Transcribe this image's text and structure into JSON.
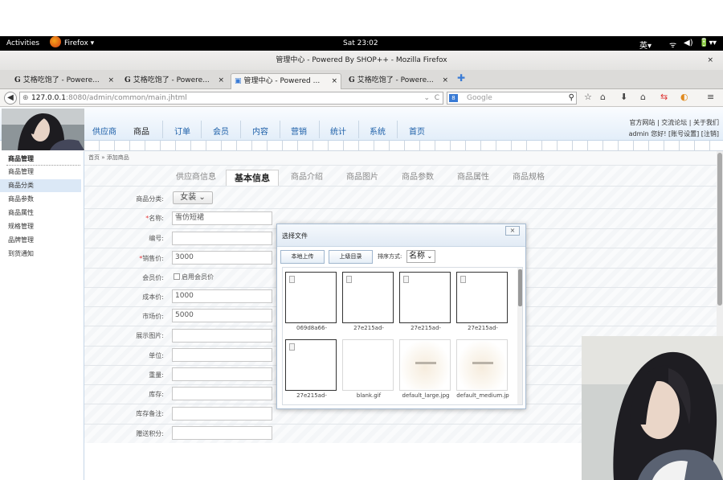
{
  "system": {
    "activities": "Activities",
    "app_menu": "Firefox ▾",
    "clock": "Sat 23:02",
    "ime": "英▾",
    "tray": [
      "ᯤ",
      "◀)",
      "🔋▾",
      "▾"
    ]
  },
  "window": {
    "title": "管理中心 - Powered By SHOP++ - Mozilla Firefox",
    "close": "×"
  },
  "tabs": [
    {
      "label": "艾格吃饱了 - Powere...",
      "glyph": "G"
    },
    {
      "label": "艾格吃饱了 - Powere...",
      "glyph": "G"
    },
    {
      "label": "管理中心 - Powered ...",
      "glyph": "▣"
    },
    {
      "label": "艾格吃饱了 - Powere...",
      "glyph": "G"
    }
  ],
  "tab_close": "×",
  "new_tab": "✚",
  "address": {
    "host": "127.0.0.1",
    "rest": ":8080/admin/common/main.jhtml",
    "dropdown": "⌄",
    "reload": "C"
  },
  "search": {
    "engine": "8",
    "placeholder": "Google",
    "icon": "⚲"
  },
  "nav_icons": [
    "☆",
    "⌂",
    "⬇",
    "⌂",
    "⇆",
    "◐",
    "≡"
  ],
  "admin_menu": [
    "供应商",
    "商品",
    "订单",
    "会员",
    "内容",
    "营销",
    "统计",
    "系统",
    "首页"
  ],
  "top_links": {
    "line1": "官方网站  |  交流论坛  |  关于我们",
    "line2": "admin 您好!  [账号设置]   [注销]"
  },
  "sidebar": {
    "heading": "商品管理",
    "items": [
      "商品管理",
      "商品分类",
      "商品参数",
      "商品属性",
      "规格管理",
      "品牌管理",
      "到货通知"
    ],
    "selected_index": 1
  },
  "breadcrumb": "首页 » 添加商品",
  "form_tabs": [
    "供应商信息",
    "基本信息",
    "商品介绍",
    "商品图片",
    "商品参数",
    "商品属性",
    "商品规格"
  ],
  "form": {
    "category_label": "商品分类:",
    "category_value": "女装",
    "name_label": "名称:",
    "name_value": "雪仿短裙",
    "sn_label": "编号:",
    "sn_value": "",
    "price_label": "销售价:",
    "price_value": "3000",
    "member_price_label": "会员价:",
    "member_price_checkbox": "启用会员价",
    "cost_label": "成本价:",
    "cost_value": "1000",
    "market_label": "市场价:",
    "market_value": "5000",
    "image_label": "展示图片:",
    "unit_label": "单位:",
    "weight_label": "重量:",
    "stock_label": "库存:",
    "stock_memo_label": "库存备注:",
    "points_label": "赠送积分:"
  },
  "dialog": {
    "title": "选择文件",
    "close": "×",
    "upload_button": "本地上传",
    "parent_button": "上级目录",
    "sort_label": "排序方式:",
    "sort_value": "名称",
    "files": [
      "069d8a66-",
      "27e215ad-",
      "27e215ad-",
      "27e215ad-",
      "27e215ad-",
      "blank.gif",
      "default_large.jpg",
      "default_medium.jp"
    ]
  }
}
